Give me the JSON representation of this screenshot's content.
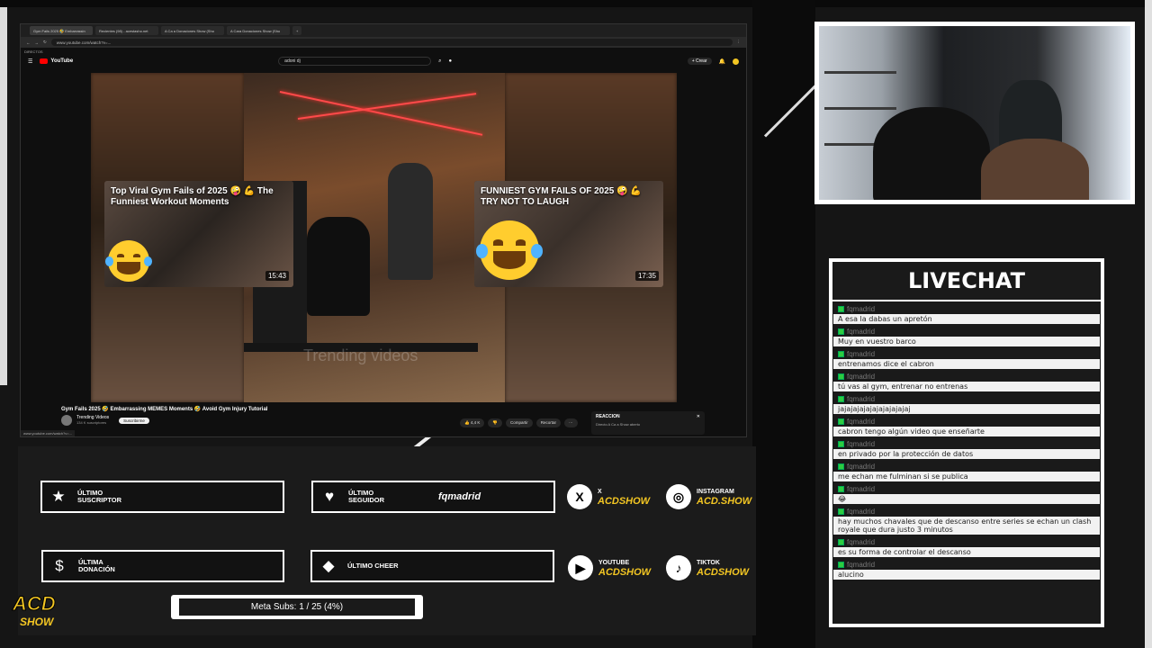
{
  "browser": {
    "tabs": [
      "Gym Fails 2025 🤣 Embarrassin",
      "Recientes (98) - acestasho.net",
      "A Ca a Donaciones Show (Sho",
      "A Cara Donaciones Show (Sho"
    ],
    "url": "www.youtube.com/watch?v=...",
    "bookmark": "DIRECTOS",
    "status_url": "www.youtube.com/watch?v=..."
  },
  "youtube": {
    "logo": "YouTube",
    "search_value": "adoni dj",
    "create_label": "+ Crear"
  },
  "video": {
    "watermark": "Trending videos",
    "title": "Gym Fails 2025 🤣 Embarrassing MEMES Moments 🤣 Avoid Gym Injury Tutorial",
    "channel": "Trending Videos",
    "subs": "134 K suscriptores",
    "subscribe": "Suscribirme",
    "likes": "4,4 K",
    "share": "Compartir",
    "clip": "Recortar",
    "more": "···",
    "cards": [
      {
        "title": "Top Viral Gym Fails of 2025 🤪 💪 The Funniest Workout Moments",
        "duration": "15:43"
      },
      {
        "title": "FUNNIEST GYM FAILS OF 2025 🤪 💪 TRY NOT TO LAUGH",
        "duration": "17:35"
      }
    ],
    "reaction_title": "REACCION",
    "reaction_sub": "Directo  A Ca a Show aberto"
  },
  "livechat": {
    "title": "LIVECHAT",
    "messages": [
      {
        "user": "fqmadrid",
        "text": "A esa la dabas un apretón"
      },
      {
        "user": "fqmadrid",
        "text": "Muy en vuestro barco"
      },
      {
        "user": "fqmadrid",
        "text": "entrenamos dice el cabron"
      },
      {
        "user": "fqmadrid",
        "text": "tú vas al gym, entrenar no entrenas"
      },
      {
        "user": "fqmadrid",
        "text": "jajajajajajajajajajajaj"
      },
      {
        "user": "fqmadrid",
        "text": "cabron tengo algún video que enseñarte"
      },
      {
        "user": "fqmadrid",
        "text": "en privado por la protección de datos"
      },
      {
        "user": "fqmadrid",
        "text": "me echan me fulminan si se publica"
      },
      {
        "user": "fqmadrid",
        "text": "😂"
      },
      {
        "user": "fqmadrid",
        "text": "hay muchos chavales que de descanso entre series se echan un clash royale que dura justo 3 minutos"
      },
      {
        "user": "fqmadrid",
        "text": "es su forma de controlar el descanso"
      },
      {
        "user": "fqmadrid",
        "text": "alucino"
      }
    ]
  },
  "alerts": {
    "subscriber_label": "ÚLTIMO SUSCRIPTOR",
    "subscriber_value": "",
    "follower_label": "ÚLTIMO SEGUIDOR",
    "follower_value": "fqmadrid",
    "donation_label": "ÚLTIMA DONACIÓN",
    "donation_value": "",
    "cheer_label": "ÚLTIMO CHEER",
    "cheer_value": ""
  },
  "socials": [
    {
      "network": "X",
      "handle": "ACDSHOW",
      "icon": "x-icon"
    },
    {
      "network": "INSTAGRAM",
      "handle": "ACD.SHOW",
      "icon": "instagram-icon"
    },
    {
      "network": "YOUTUBE",
      "handle": "ACDSHOW",
      "icon": "youtube-icon"
    },
    {
      "network": "TIKTOK",
      "handle": "ACDSHOW",
      "icon": "tiktok-icon"
    }
  ],
  "goal": {
    "text": "Meta Subs: 1 / 25 (4%)",
    "current": 1,
    "target": 25
  },
  "logo": {
    "line1": "ACD",
    "line2": "SHOW"
  },
  "colors": {
    "accent": "#f3c623",
    "chat_badge": "#2ecc40",
    "youtube_red": "#ff0000"
  }
}
